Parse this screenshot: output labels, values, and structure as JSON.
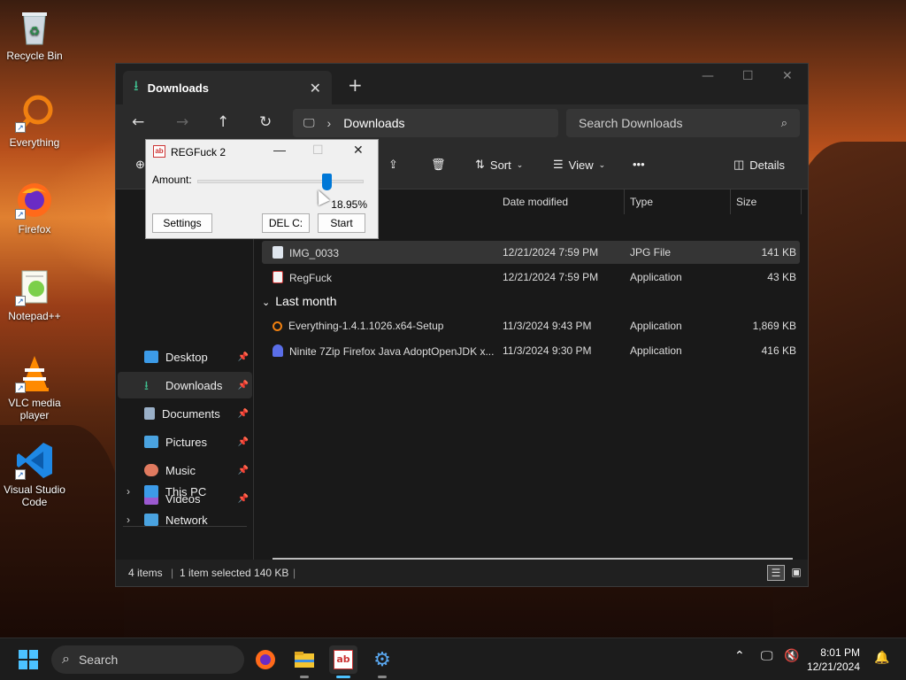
{
  "desktop": {
    "icons": [
      {
        "label": "Recycle Bin",
        "icon": "recycle-bin-icon"
      },
      {
        "label": "Everything",
        "icon": "everything-icon"
      },
      {
        "label": "Firefox",
        "icon": "firefox-icon"
      },
      {
        "label": "Notepad++",
        "icon": "notepad-plus-plus-icon"
      },
      {
        "label": "VLC media player",
        "icon": "vlc-icon"
      },
      {
        "label": "Visual Studio Code",
        "icon": "vscode-icon"
      }
    ]
  },
  "explorer": {
    "tab_title": "Downloads",
    "address_location": "Downloads",
    "search_placeholder": "Search Downloads",
    "toolbar": {
      "sort": "Sort",
      "view": "View",
      "more": "•••",
      "details": "Details"
    },
    "nav_quick": [
      {
        "label": "Desktop",
        "color": "#3c9be8"
      },
      {
        "label": "Downloads",
        "color": "#3fbf8f"
      },
      {
        "label": "Documents",
        "color": "#9ab0c8"
      },
      {
        "label": "Pictures",
        "color": "#4aa3e0"
      },
      {
        "label": "Music",
        "color": "#e07a5f"
      },
      {
        "label": "Videos",
        "color": "#9b59d0"
      }
    ],
    "nav_tree": [
      {
        "label": "This PC"
      },
      {
        "label": "Network"
      }
    ],
    "columns": {
      "date": "Date modified",
      "type": "Type",
      "size": "Size"
    },
    "groups": {
      "last_month": "Last month"
    },
    "files": [
      {
        "name": "IMG_0033",
        "date": "12/21/2024 7:59 PM",
        "type": "JPG File",
        "size": "141 KB"
      },
      {
        "name": "RegFuck",
        "date": "12/21/2024 7:59 PM",
        "type": "Application",
        "size": "43 KB"
      },
      {
        "name": "Everything-1.4.1.1026.x64-Setup",
        "date": "11/3/2024 9:43 PM",
        "type": "Application",
        "size": "1,869 KB"
      },
      {
        "name": "Ninite 7Zip Firefox Java AdoptOpenJDK x...",
        "date": "11/3/2024 9:30 PM",
        "type": "Application",
        "size": "416 KB"
      }
    ],
    "status": {
      "items": "4 items",
      "selected": "1 item selected  140 KB"
    }
  },
  "regfuck": {
    "title": "REGFuck 2",
    "amount_label": "Amount:",
    "amount_value": 0.78,
    "percent": "18.95%",
    "settings": "Settings",
    "del": "DEL C:",
    "start": "Start"
  },
  "taskbar": {
    "search": "Search",
    "time": "8:01 PM",
    "date": "12/21/2024"
  }
}
